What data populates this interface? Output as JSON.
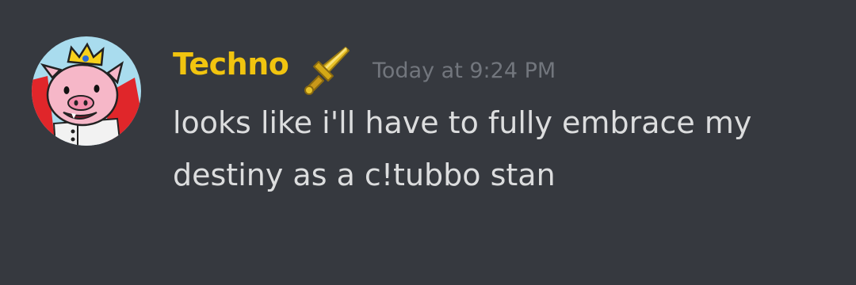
{
  "message": {
    "author": {
      "name": "Techno",
      "name_color": "#f1c40f",
      "avatar_icon": "pig-king-avatar",
      "badge_icon": "golden-sword-icon"
    },
    "timestamp": "Today at 9:24 PM",
    "content_lines": [
      "looks like i'll have to fully embrace my",
      "destiny as a c!tubbo stan"
    ]
  },
  "theme": {
    "background": "#36393f",
    "timestamp_color": "#72767d",
    "text_color": "#dcddde"
  }
}
